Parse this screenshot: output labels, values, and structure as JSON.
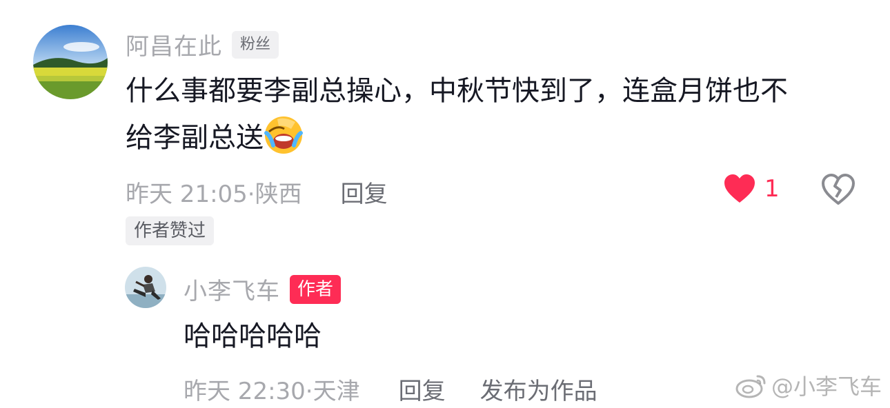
{
  "comment": {
    "author": "阿昌在此",
    "badge": "粉丝",
    "text_line1": "什么事都要李副总操心，中秋节快到了，连盒月饼也不",
    "text_line2": "给李副总送",
    "emoji": "face-with-open-mouth-crying-emoji",
    "time": "昨天 21:05·",
    "location": "陕西",
    "reply_label": "回复",
    "like_count": "1",
    "liked_by_author": "作者赞过",
    "colors": {
      "like": "#fe2c55",
      "author_tag": "#fe2c55"
    }
  },
  "reply": {
    "author": "小李飞车",
    "badge": "作者",
    "text": "哈哈哈哈哈",
    "time": "昨天 22:30·",
    "location": "天津",
    "reply_label": "回复",
    "publish_label": "发布为作品"
  },
  "watermark": {
    "text": "@小李飞车",
    "icon": "weibo-logo-icon"
  }
}
